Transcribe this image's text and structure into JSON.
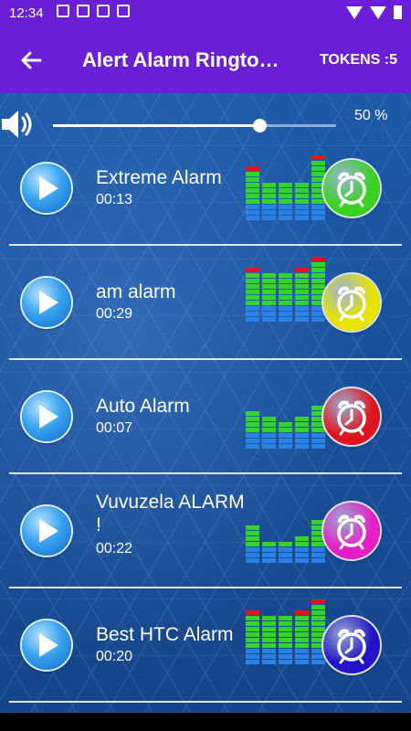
{
  "status": {
    "time": "12:34"
  },
  "appbar": {
    "title": "Alert Alarm Ringto…",
    "tokens": "TOKENS :5"
  },
  "volume": {
    "value_label": "50 %",
    "level": 0.73
  },
  "colors": {
    "bar": "#6a1fd6",
    "green": "#3ad21e",
    "yellow": "#e8e400",
    "red": "#e0141e",
    "magenta": "#e61ec8",
    "blue": "#2214c8"
  },
  "ringtones": [
    {
      "title": "Extreme Alarm",
      "duration": "00:13",
      "alarm_color": "#3ad21e",
      "eq": [
        10,
        7,
        7,
        7,
        12
      ]
    },
    {
      "title": "am alarm",
      "duration": "00:29",
      "alarm_color": "#e8e400",
      "eq": [
        10,
        9,
        9,
        10,
        12
      ]
    },
    {
      "title": "Auto Alarm",
      "duration": "00:07",
      "alarm_color": "#e0141e",
      "eq": [
        7,
        6,
        5,
        6,
        8
      ]
    },
    {
      "title": "Vuvuzela ALARM !",
      "duration": "00:22",
      "alarm_color": "#e61ec8",
      "eq": [
        7,
        4,
        4,
        5,
        8
      ]
    },
    {
      "title": "Best HTC Alarm",
      "duration": "00:20",
      "alarm_color": "#2214c8",
      "eq": [
        10,
        9,
        9,
        10,
        12
      ]
    }
  ]
}
